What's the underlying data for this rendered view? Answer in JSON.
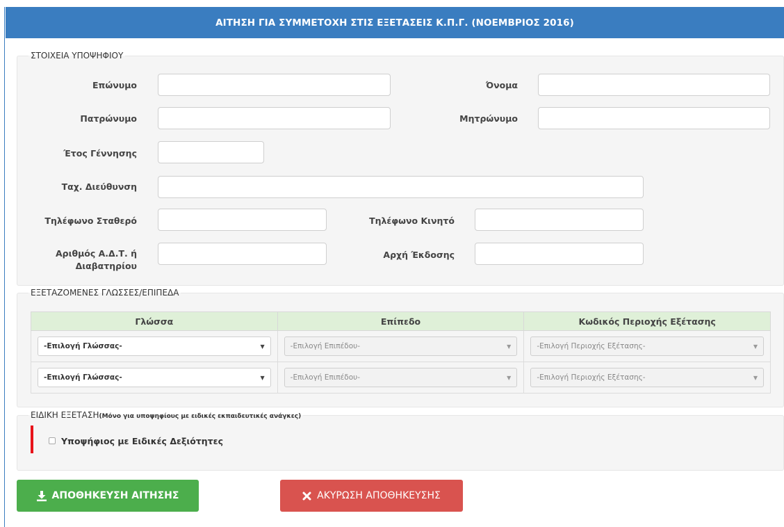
{
  "header": {
    "title": "ΑΙΤΗΣΗ ΓΙΑ ΣΥΜΜΕΤΟΧΗ ΣΤΙΣ ΕΞΕΤΑΣΕΙΣ Κ.Π.Γ. (ΝΟΕΜΒΡΙΟΣ 2016)"
  },
  "candidate": {
    "legend": "ΣΤΟΙΧΕΙΑ ΥΠΟΨΗΦΙΟΥ",
    "surname_label": "Επώνυμο",
    "surname_value": "",
    "name_label": "Όνομα",
    "name_value": "",
    "father_label": "Πατρώνυμο",
    "father_value": "",
    "mother_label": "Μητρώνυμο",
    "mother_value": "",
    "birth_year_label": "Έτος Γέννησης",
    "birth_year_value": "",
    "address_label": "Ταχ. Διεύθυνση",
    "address_value": "",
    "phone_label": "Τηλέφωνο Σταθερό",
    "phone_value": "",
    "mobile_label": "Τηλέφωνο Κινητό",
    "mobile_value": "",
    "id_label_line1": "Αριθμός Α.Δ.Τ. ή",
    "id_label_line2": "Διαβατηρίου",
    "id_value": "",
    "issuer_label": "Αρχή Έκδοσης",
    "issuer_value": ""
  },
  "languages": {
    "legend": "ΕΞΕΤΑΖΟΜΕΝΕΣ ΓΛΩΣΣΕΣ/ΕΠΙΠΕΔΑ",
    "columns": [
      "Γλώσσα",
      "Επίπεδο",
      "Κωδικός Περιοχής Εξέτασης"
    ],
    "rows": [
      {
        "language": "-Επιλογή Γλώσσας-",
        "level": "-Επιλογή Επιπέδου-",
        "region": "-Επιλογή Περιοχής Εξέτασης-"
      },
      {
        "language": "-Επιλογή Γλώσσας-",
        "level": "-Επιλογή Επιπέδου-",
        "region": "-Επιλογή Περιοχής Εξέτασης-"
      }
    ]
  },
  "special": {
    "legend": "ΕΙΔΙΚΗ ΕΞΕΤΑΣΗ",
    "legend_note": "(Μόνο για υποψηφίους με ειδικές εκπαιδευτικές ανάγκες)",
    "checkbox_label": "Υποψήφιος με Ειδικές Δεξιότητες",
    "accent_color": "#e8131a"
  },
  "actions": {
    "save_label": "ΑΠΟΘΗΚΕΥΣΗ ΑΙΤΗΣΗΣ",
    "save_icon": "download-icon",
    "save_color": "#4cae4c",
    "cancel_label": "ΑΚΥΡΩΣΗ ΑΠΟΘΗΚΕΥΣΗΣ",
    "cancel_icon": "close-icon",
    "cancel_color": "#d9534f"
  },
  "theme": {
    "header_color": "#3a7dc0",
    "table_header_color": "#dff0d8"
  }
}
